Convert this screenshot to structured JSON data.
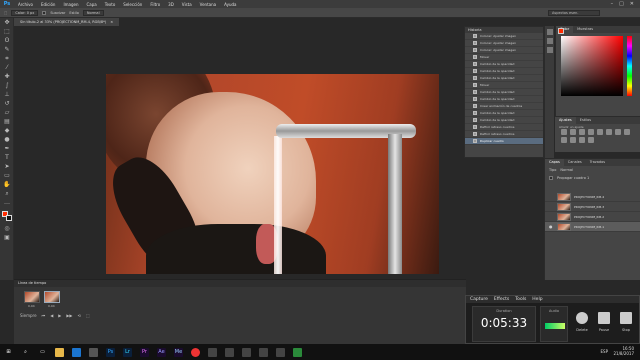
{
  "app": {
    "logo": "Ps"
  },
  "menubar": {
    "items": [
      "Archivo",
      "Edición",
      "Imagen",
      "Capa",
      "Texto",
      "Selección",
      "Filtro",
      "3D",
      "Vista",
      "Ventana",
      "Ayuda"
    ],
    "window_controls": [
      "–",
      "□",
      "✕"
    ]
  },
  "options": {
    "move_icon": "move-tool-icon",
    "feather_label": "Calar: 0 px",
    "style_label": "Estilo",
    "style_value": "Normal",
    "antialias_label": "Suavizar",
    "workspace": "Aspectos esen."
  },
  "doc_tab": {
    "title": "Sin título-2 al 33% (PROJECTIONM_RM-4, RGB/8*)",
    "close": "×"
  },
  "timeline": {
    "title": "Línea de tiempo",
    "frames": [
      {
        "label": "0,04"
      },
      {
        "label": "0,04"
      }
    ],
    "loop": "Siempre",
    "controls": [
      "⏮",
      "◀",
      "▶",
      "▶▶",
      "⟲",
      "⬚"
    ]
  },
  "history": {
    "title": "Historia",
    "items": [
      "Colocar: Ajustar imagen",
      "Colocar: Ajustar imagen",
      "Colocar: Ajustar imagen",
      "Mover",
      "Cambio de la opacidad",
      "Cambio de la opacidad",
      "Cambio de la opacidad",
      "Mover",
      "Cambio de la opacidad",
      "Cambio de la opacidad",
      "Crear animación de cuadros",
      "Cambio de la opacidad",
      "Cambio de la opacidad",
      "Definir retraso cuadros",
      "Definir retraso cuadros",
      "Duplicar cuadro"
    ],
    "active_index": 15
  },
  "color": {
    "tabs": [
      "Color",
      "Muestras"
    ],
    "foreground": "#ff2b00",
    "background": "#111111"
  },
  "adjustments": {
    "tabs": [
      "Ajustes",
      "Estilos"
    ],
    "subtitle": "Añadir un ajuste"
  },
  "layers": {
    "tabs": [
      "Capas",
      "Canales",
      "Trazados"
    ],
    "kind": "Tipo",
    "blend": "Normal",
    "propagate": "Propagar cuadro 1",
    "items": [
      "PROJECTIONM_RM-4",
      "PROJECTIONM_RM-3",
      "PROJECTIONM_RM-2",
      "PROJECTIONM_RM-1"
    ],
    "active_index": 3
  },
  "recorder": {
    "menu": [
      "Capture",
      "Effects",
      "Tools",
      "Help"
    ],
    "duration_label": "Duration",
    "time": "0:05:33",
    "audio_label": "Audio",
    "buttons": [
      "Delete",
      "Pause",
      "Stop"
    ]
  },
  "taskbar": {
    "lang": "ESP",
    "time": "16:50",
    "date": "21/8/2017"
  }
}
